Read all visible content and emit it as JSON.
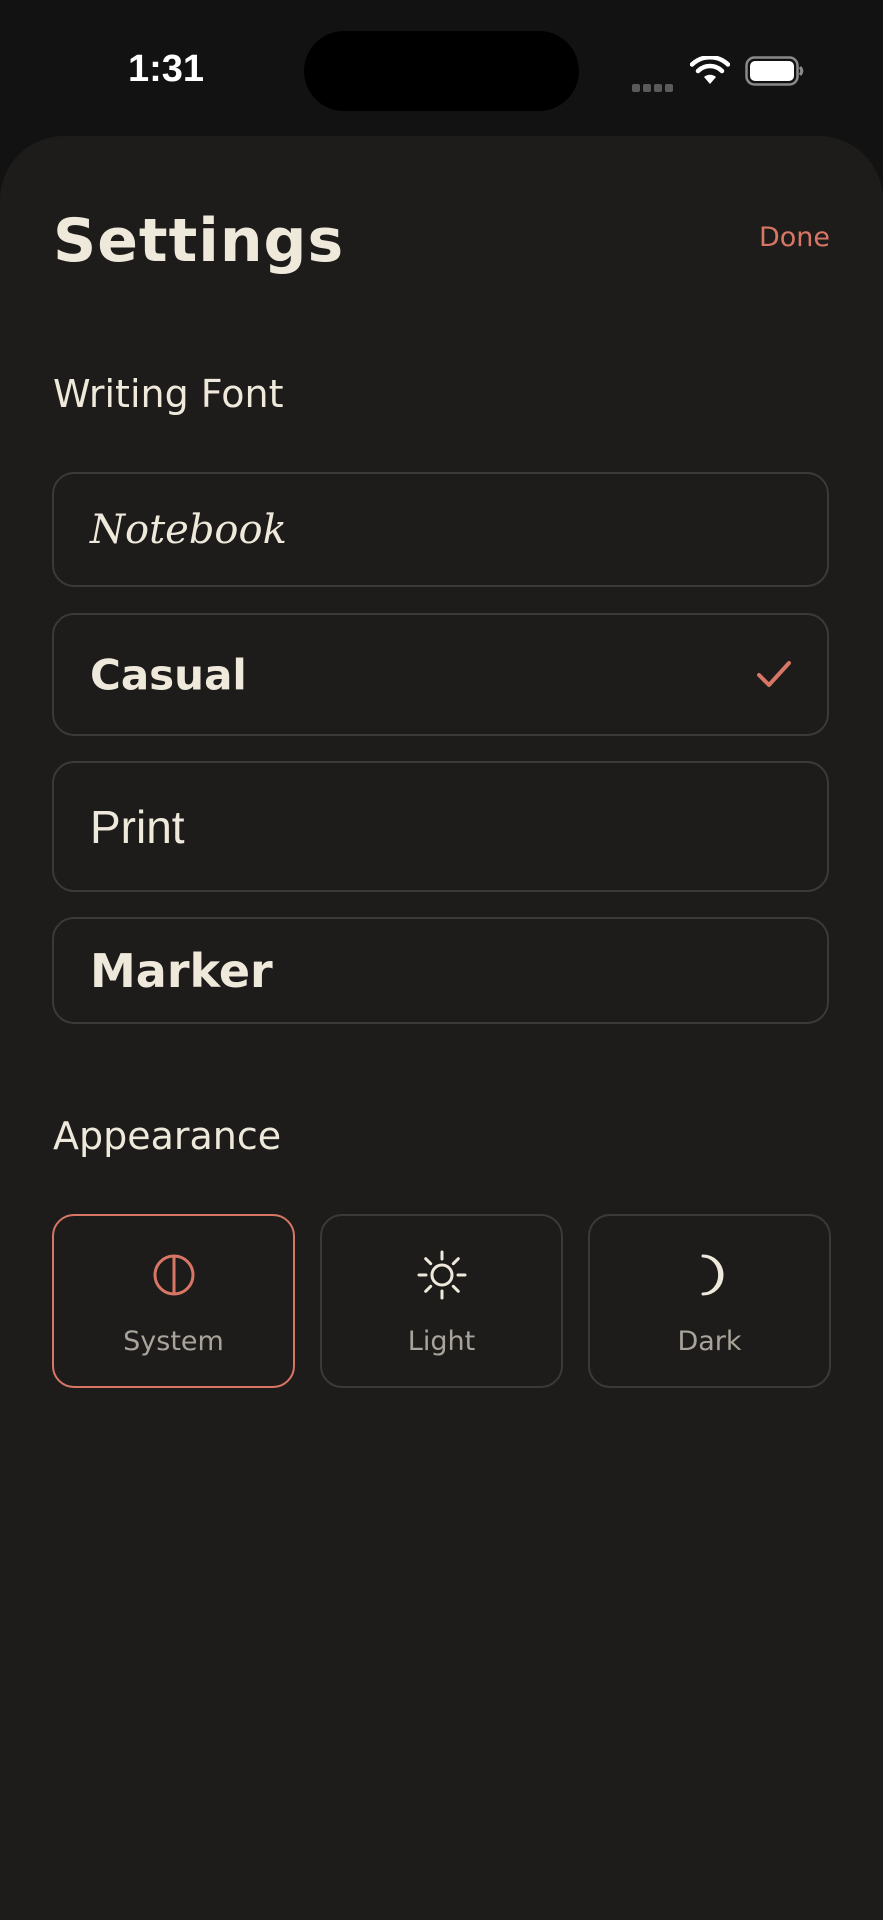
{
  "status_bar": {
    "time": "1:31"
  },
  "sheet": {
    "title": "Settings",
    "done_label": "Done"
  },
  "writing_font": {
    "section_label": "Writing Font",
    "options": [
      {
        "label": "Notebook",
        "selected": false
      },
      {
        "label": "Casual",
        "selected": true
      },
      {
        "label": "Print",
        "selected": false
      },
      {
        "label": "Marker",
        "selected": false
      }
    ]
  },
  "appearance": {
    "section_label": "Appearance",
    "options": [
      {
        "label": "System",
        "icon": "half-circle-icon",
        "selected": true
      },
      {
        "label": "Light",
        "icon": "sun-icon",
        "selected": false
      },
      {
        "label": "Dark",
        "icon": "moon-icon",
        "selected": false
      }
    ]
  },
  "colors": {
    "accent": "#d87665",
    "sheet_background": "#1d1c1a",
    "text_primary": "#efe9dc",
    "text_secondary": "#a9a49b",
    "border": "#3b3a37"
  }
}
